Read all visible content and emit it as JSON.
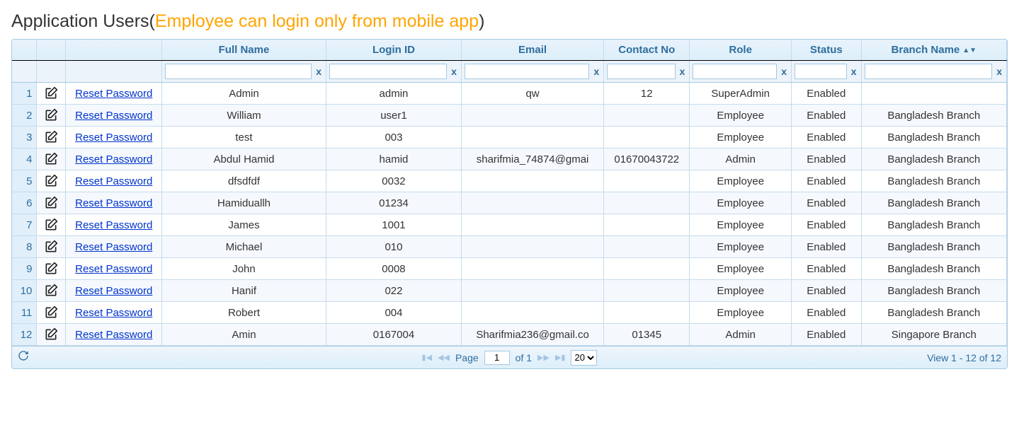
{
  "title_main": "Application Users",
  "title_paren_open": "(",
  "title_sub": "Employee can login only from mobile app",
  "title_paren_close": ")",
  "columns": {
    "full_name": "Full Name",
    "login_id": "Login ID",
    "email": "Email",
    "contact_no": "Contact No",
    "role": "Role",
    "status": "Status",
    "branch_name": "Branch Name"
  },
  "filter_clear": "x",
  "reset_label": "Reset Password",
  "rows": [
    {
      "n": "1",
      "full_name": "Admin",
      "login_id": "admin",
      "email": "qw",
      "contact_no": "12",
      "role": "SuperAdmin",
      "status": "Enabled",
      "branch": ""
    },
    {
      "n": "2",
      "full_name": "William",
      "login_id": "user1",
      "email": "",
      "contact_no": "",
      "role": "Employee",
      "status": "Enabled",
      "branch": "Bangladesh Branch"
    },
    {
      "n": "3",
      "full_name": "test",
      "login_id": "003",
      "email": "",
      "contact_no": "",
      "role": "Employee",
      "status": "Enabled",
      "branch": "Bangladesh Branch"
    },
    {
      "n": "4",
      "full_name": "Abdul Hamid",
      "login_id": "hamid",
      "email": "sharifmia_74874@gmai",
      "contact_no": "01670043722",
      "role": "Admin",
      "status": "Enabled",
      "branch": "Bangladesh Branch"
    },
    {
      "n": "5",
      "full_name": "dfsdfdf",
      "login_id": "0032",
      "email": "",
      "contact_no": "",
      "role": "Employee",
      "status": "Enabled",
      "branch": "Bangladesh Branch"
    },
    {
      "n": "6",
      "full_name": "Hamiduallh",
      "login_id": "01234",
      "email": "",
      "contact_no": "",
      "role": "Employee",
      "status": "Enabled",
      "branch": "Bangladesh Branch"
    },
    {
      "n": "7",
      "full_name": "James",
      "login_id": "1001",
      "email": "",
      "contact_no": "",
      "role": "Employee",
      "status": "Enabled",
      "branch": "Bangladesh Branch"
    },
    {
      "n": "8",
      "full_name": "Michael",
      "login_id": "010",
      "email": "",
      "contact_no": "",
      "role": "Employee",
      "status": "Enabled",
      "branch": "Bangladesh Branch"
    },
    {
      "n": "9",
      "full_name": "John",
      "login_id": "0008",
      "email": "",
      "contact_no": "",
      "role": "Employee",
      "status": "Enabled",
      "branch": "Bangladesh Branch"
    },
    {
      "n": "10",
      "full_name": "Hanif",
      "login_id": "022",
      "email": "",
      "contact_no": "",
      "role": "Employee",
      "status": "Enabled",
      "branch": "Bangladesh Branch"
    },
    {
      "n": "11",
      "full_name": "Robert",
      "login_id": "004",
      "email": "",
      "contact_no": "",
      "role": "Employee",
      "status": "Enabled",
      "branch": "Bangladesh Branch"
    },
    {
      "n": "12",
      "full_name": "Amin",
      "login_id": "0167004",
      "email": "Sharifmia236@gmail.co",
      "contact_no": "01345",
      "role": "Admin",
      "status": "Enabled",
      "branch": "Singapore Branch"
    }
  ],
  "pager": {
    "page_label": "Page",
    "page_value": "1",
    "of_label": "of 1",
    "per_page": "20",
    "view_text": "View 1 - 12 of 12"
  }
}
